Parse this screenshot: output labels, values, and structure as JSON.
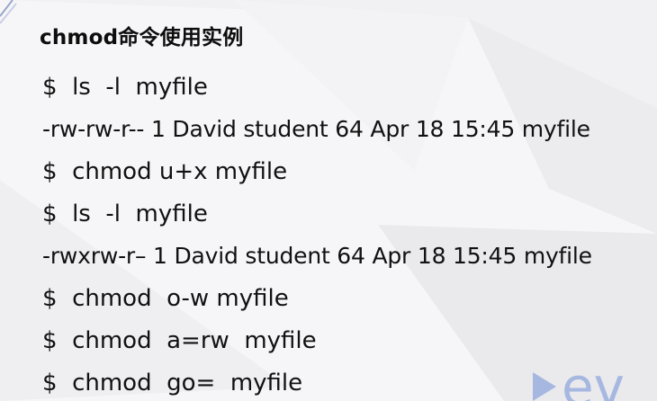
{
  "slide": {
    "title": "chmod命令使用实例",
    "lines": [
      "$  ls  -l  myfile",
      "-rw-rw-r-- 1 David student 64 Apr 18 15:45 myfile",
      "$  chmod u+x myfile",
      "$  ls  -l  myfile",
      "-rwxrw-r– 1 David student 64 Apr 18 15:45 myfile",
      "$  chmod  o-w myfile",
      "$  chmod  a=rw  myfile",
      "$  chmod  go=  myfile"
    ]
  },
  "watermark": {
    "text": "ev"
  },
  "colors": {
    "background": "#f6f6f8",
    "text": "#111111",
    "watermark": "#6f8fd6"
  }
}
